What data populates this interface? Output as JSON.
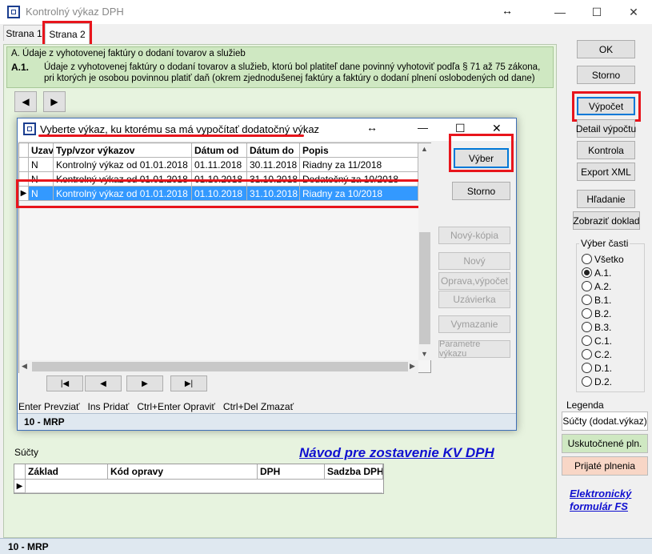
{
  "window": {
    "title": "Kontrolný výkaz DPH",
    "resize_glyph": "↔",
    "minimize_glyph": "—",
    "maximize_glyph": "☐",
    "close_glyph": "✕"
  },
  "tabs": [
    {
      "label": "Strana 1",
      "active": false
    },
    {
      "label": "Strana 2",
      "active": true
    }
  ],
  "section": {
    "title": "A. Údaje z vyhotovenej faktúry o dodaní tovarov a služieb",
    "code": "A.1.",
    "description": "Údaje z vyhotovenej faktúry o dodaní tovarov a služieb, ktorú bol platiteľ dane povinný vyhotoviť podľa § 71 až 75 zákona, pri ktorých je osobou povinnou platiť daň (okrem zjednodušenej faktúry a faktúry o dodaní plnení oslobodených od dane)"
  },
  "page_nav": {
    "prev_glyph": "◀",
    "next_glyph": "▶"
  },
  "right_buttons": {
    "ok": "OK",
    "storno": "Storno",
    "vypocet": "Výpočet",
    "detail": "Detail výpočtu",
    "kontrola": "Kontrola",
    "export": "Export XML",
    "hladanie": "Hľadanie",
    "zobrazit": "Zobraziť doklad"
  },
  "parts": {
    "label": "Výber časti",
    "selected": "A.1.",
    "options": [
      "Všetko",
      "A.1.",
      "A.2.",
      "B.1.",
      "B.2.",
      "B.3.",
      "C.1.",
      "C.2.",
      "D.1.",
      "D.2."
    ]
  },
  "legend": {
    "label": "Legenda",
    "items": [
      {
        "label": "Súčty (dodat.výkaz)",
        "color": "#ffffff"
      },
      {
        "label": "Uskutočnené pln.",
        "color": "#cfe8c2"
      },
      {
        "label": "Prijaté plnenia",
        "color": "#f8d6c6"
      }
    ]
  },
  "links": {
    "guide": "Návod pre zostavenie KV DPH",
    "form_line1": "Elektronický",
    "form_line2": "formulár FS"
  },
  "sums": {
    "label": "Súčty",
    "columns": [
      "Základ",
      "Kód opravy",
      "DPH",
      "Sadzba DPH"
    ]
  },
  "footer": {
    "status": "10 - MRP"
  },
  "dialog": {
    "title": "Vyberte výkaz, ku ktorému sa má vypočítať dodatočný výkaz",
    "resize_glyph": "↔",
    "minimize_glyph": "—",
    "maximize_glyph": "☐",
    "close_glyph": "✕",
    "columns": [
      "Uzav",
      "Typ/vzor výkazov",
      "Dátum od",
      "Dátum do",
      "Popis"
    ],
    "rows": [
      {
        "uzav": "N",
        "typ": "Kontrolný výkaz od 01.01.2018",
        "od": "01.11.2018",
        "do": "30.11.2018",
        "popis": "Riadny za 11/2018",
        "selected": false
      },
      {
        "uzav": "N",
        "typ": "Kontrolný výkaz od 01.01.2018",
        "od": "01.10.2018",
        "do": "31.10.2018",
        "popis": "Dodatočný za 10/2018",
        "selected": false
      },
      {
        "uzav": "N",
        "typ": "Kontrolný výkaz od 01.01.2018",
        "od": "01.10.2018",
        "do": "31.10.2018",
        "popis": "Riadny za 10/2018",
        "selected": true
      }
    ],
    "buttons": {
      "vyber": "Výber",
      "storno": "Storno",
      "nova_kopia": "Nový-kópia",
      "novy": "Nový",
      "oprava": "Oprava,výpočet",
      "uzavierka": "Uzávierka",
      "vymazanie": "Vymazanie",
      "parametre": "Parametre výkazu"
    },
    "nav": {
      "first": "|◀",
      "prev": "◀",
      "next": "▶",
      "last": "▶|"
    },
    "shortcuts": "Enter Prevziať   Ins Pridať   Ctrl+Enter Opraviť   Ctrl+Del Zmazať",
    "status": "10 - MRP"
  },
  "colors": {
    "highlight": "#e8151c",
    "selection": "#3399ff",
    "link": "#1010d0"
  }
}
